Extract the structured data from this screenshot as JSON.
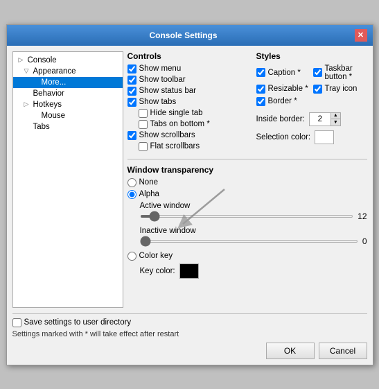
{
  "window": {
    "title": "Console Settings",
    "close_label": "✕"
  },
  "sidebar": {
    "items": [
      {
        "id": "console",
        "label": "Console",
        "indent": 0,
        "expander": "▷"
      },
      {
        "id": "appearance",
        "label": "Appearance",
        "indent": 1,
        "expander": "▽"
      },
      {
        "id": "more",
        "label": "More...",
        "indent": 2,
        "expander": "",
        "selected": true
      },
      {
        "id": "behavior",
        "label": "Behavior",
        "indent": 1,
        "expander": ""
      },
      {
        "id": "hotkeys",
        "label": "Hotkeys",
        "indent": 1,
        "expander": "▷"
      },
      {
        "id": "mouse",
        "label": "Mouse",
        "indent": 2,
        "expander": ""
      },
      {
        "id": "tabs",
        "label": "Tabs",
        "indent": 1,
        "expander": ""
      }
    ]
  },
  "controls": {
    "title": "Controls",
    "items": [
      {
        "id": "show_menu",
        "label": "Show menu",
        "checked": true,
        "indent": 0
      },
      {
        "id": "show_toolbar",
        "label": "Show toolbar",
        "checked": true,
        "indent": 0
      },
      {
        "id": "show_status_bar",
        "label": "Show status bar",
        "checked": true,
        "indent": 0
      },
      {
        "id": "show_tabs",
        "label": "Show tabs",
        "checked": true,
        "indent": 0
      },
      {
        "id": "hide_single_tab",
        "label": "Hide single tab",
        "checked": false,
        "indent": 1
      },
      {
        "id": "tabs_on_bottom",
        "label": "Tabs on bottom *",
        "checked": false,
        "indent": 1
      },
      {
        "id": "show_scrollbars",
        "label": "Show scrollbars",
        "checked": true,
        "indent": 0
      },
      {
        "id": "flat_scrollbars",
        "label": "Flat scrollbars",
        "checked": false,
        "indent": 1
      }
    ]
  },
  "styles": {
    "title": "Styles",
    "items": [
      {
        "id": "caption",
        "label": "Caption *",
        "checked": true
      },
      {
        "id": "taskbar_button",
        "label": "Taskbar button *",
        "checked": true
      },
      {
        "id": "resizable",
        "label": "Resizable *",
        "checked": true
      },
      {
        "id": "tray_icon",
        "label": "Tray icon",
        "checked": true
      },
      {
        "id": "border",
        "label": "Border *",
        "checked": true
      }
    ],
    "inside_border_label": "Inside border:",
    "inside_border_value": "2",
    "selection_color_label": "Selection color:"
  },
  "transparency": {
    "title": "Window transparency",
    "options": [
      {
        "id": "none",
        "label": "None",
        "selected": false
      },
      {
        "id": "alpha",
        "label": "Alpha",
        "selected": true
      },
      {
        "id": "color_key",
        "label": "Color key",
        "selected": false
      }
    ],
    "active_window_label": "Active window",
    "active_window_value": 12,
    "inactive_window_label": "Inactive window",
    "inactive_window_value": 0,
    "key_color_label": "Key color:"
  },
  "footer": {
    "save_settings_label": "Save settings to user directory",
    "note_text": "Settings marked with * will take effect after restart",
    "ok_label": "OK",
    "cancel_label": "Cancel"
  }
}
